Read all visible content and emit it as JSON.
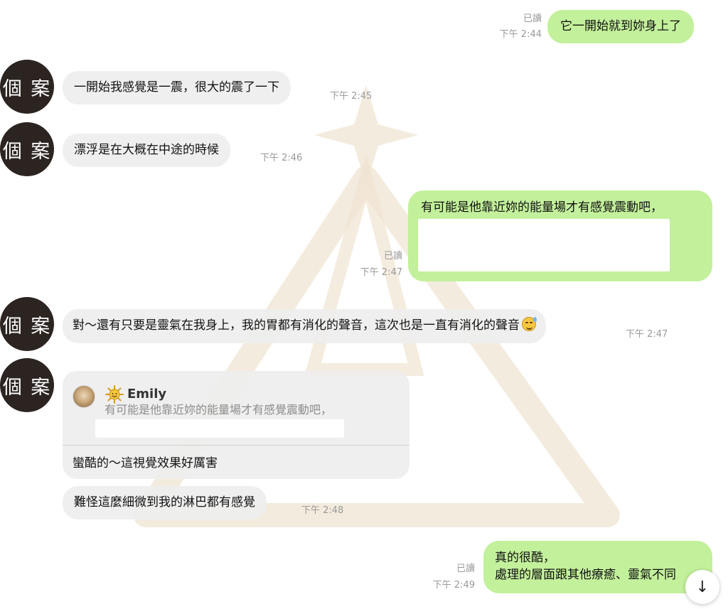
{
  "contact": {
    "avatar_text": "個 案"
  },
  "messages": [
    {
      "text": "它一開始就到妳身上了",
      "read": "已讀",
      "time": "下午 2:44"
    },
    {
      "text": "一開始我感覺是一震，很大的震了一下",
      "time": "下午 2:45"
    },
    {
      "text": "漂浮是在大概在中途的時候",
      "time": "下午 2:46"
    },
    {
      "text": "有可能是他靠近妳的能量場才有感覺震動吧，",
      "read": "已讀",
      "time": "下午 2:47"
    },
    {
      "text": "對～還有只要是靈氣在我身上，我的胃都有消化的聲音，這次也是一直有消化的聲音",
      "emoji": "sweat-smile-emoji",
      "time": "下午 2:47"
    },
    {
      "reply": {
        "name": "Emily",
        "name_icon": "sun-icon",
        "quoted_text": "有可能是他靠近妳的能量場才有感覺震動吧，"
      },
      "text": "蠻酷的～這視覺效果好厲害"
    },
    {
      "text": "難怪這麼細微到我的淋巴都有感覺",
      "time": "下午 2:48"
    },
    {
      "line1": "真的很酷，",
      "line2": "處理的層面跟其他療癒、靈氣不同",
      "read": "已讀",
      "time": "下午 2:49"
    }
  ],
  "controls": {
    "scroll_down_icon": "arrow-down-icon",
    "scroll_down_glyph": "↓"
  },
  "colors": {
    "outgoing_bubble": "#c1ef97",
    "incoming_bubble": "#eeeeee",
    "avatar_bg": "#2b2421"
  }
}
